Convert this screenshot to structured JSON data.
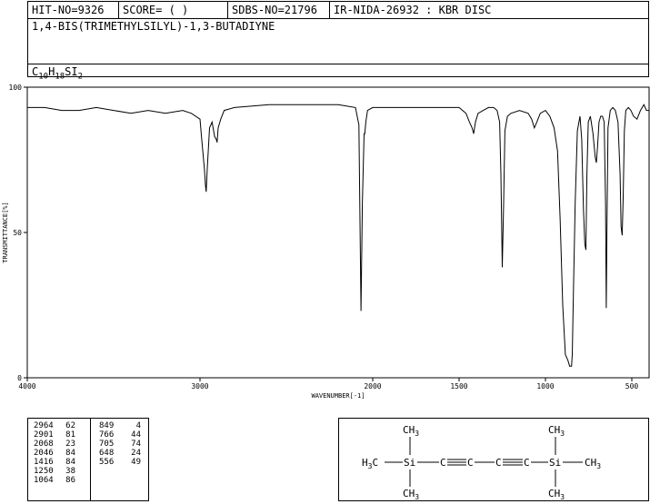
{
  "header": {
    "hit_no": "HIT-NO=9326",
    "score": "SCORE=  (   )",
    "sdbs_no": "SDBS-NO=21796",
    "ir_info": "IR-NIDA-26932 : KBR DISC",
    "compound_name": "1,4-BIS(TRIMETHYLSILYL)-1,3-BUTADIYNE",
    "formula_parts": [
      "C",
      "10",
      "H",
      "18",
      "SI",
      "2"
    ]
  },
  "chart_data": {
    "type": "line",
    "xlabel": "WAVENUMBER[-1]",
    "ylabel": "TRANSMITTANCE[%]",
    "xlim": [
      4000,
      400
    ],
    "ylim": [
      0,
      100
    ],
    "x_ticks": [
      4000,
      3000,
      2000,
      1500,
      1000,
      500
    ],
    "y_ticks": [
      0,
      50,
      100
    ],
    "series": [
      {
        "x": [
          4000,
          3900,
          3800,
          3700,
          3600,
          3500,
          3400,
          3300,
          3200,
          3100,
          3050,
          3000,
          2990,
          2975,
          2968,
          2964,
          2958,
          2945,
          2930,
          2915,
          2905,
          2901,
          2895,
          2880,
          2860,
          2800,
          2600,
          2400,
          2200,
          2100,
          2080,
          2068,
          2060,
          2050,
          2046,
          2040,
          2030,
          2000,
          1900,
          1800,
          1700,
          1600,
          1500,
          1460,
          1440,
          1425,
          1416,
          1405,
          1390,
          1360,
          1330,
          1300,
          1280,
          1265,
          1258,
          1250,
          1242,
          1235,
          1220,
          1200,
          1150,
          1100,
          1080,
          1064,
          1050,
          1030,
          1000,
          975,
          950,
          930,
          915,
          900,
          885,
          870,
          860,
          852,
          849,
          845,
          838,
          828,
          815,
          800,
          790,
          780,
          772,
          766,
          760,
          752,
          740,
          725,
          712,
          705,
          698,
          690,
          680,
          670,
          660,
          652,
          648,
          644,
          638,
          625,
          610,
          595,
          580,
          568,
          562,
          556,
          550,
          543,
          535,
          520,
          505,
          490,
          470,
          450,
          430,
          415,
          400
        ],
        "y": [
          93,
          93,
          92,
          92,
          93,
          92,
          91,
          92,
          91,
          92,
          91,
          89,
          82,
          72,
          66,
          64,
          72,
          86,
          88,
          83,
          82,
          81,
          86,
          89,
          92,
          93,
          94,
          94,
          94,
          93,
          87,
          23,
          60,
          84,
          84,
          88,
          92,
          93,
          93,
          93,
          93,
          93,
          93,
          91,
          88,
          86,
          84,
          88,
          91,
          92,
          93,
          93,
          92,
          88,
          70,
          38,
          60,
          85,
          90,
          91,
          92,
          91,
          89,
          86,
          88,
          91,
          92,
          90,
          86,
          78,
          55,
          25,
          8,
          6,
          4,
          4,
          4,
          8,
          30,
          60,
          85,
          90,
          82,
          58,
          46,
          44,
          70,
          88,
          90,
          84,
          76,
          74,
          80,
          88,
          90,
          90,
          88,
          60,
          24,
          50,
          86,
          92,
          93,
          92,
          88,
          70,
          52,
          49,
          62,
          85,
          92,
          93,
          92,
          90,
          89,
          92,
          94,
          92,
          92
        ]
      }
    ],
    "grid": false
  },
  "peak_table": {
    "left": [
      [
        "2964",
        "62"
      ],
      [
        "2901",
        "81"
      ],
      [
        "2068",
        "23"
      ],
      [
        "2046",
        "84"
      ],
      [
        "1416",
        "84"
      ],
      [
        "1250",
        "38"
      ],
      [
        "1064",
        "86"
      ]
    ],
    "right": [
      [
        "849",
        "4"
      ],
      [
        "766",
        "44"
      ],
      [
        "705",
        "74"
      ],
      [
        "648",
        "24"
      ],
      [
        "556",
        "49"
      ]
    ]
  },
  "structure": {
    "ch3": "CH",
    "three": "3",
    "h3c": "H",
    "h3c_sub": "3",
    "h3c_c": "C",
    "si": "Si",
    "c": "C"
  }
}
